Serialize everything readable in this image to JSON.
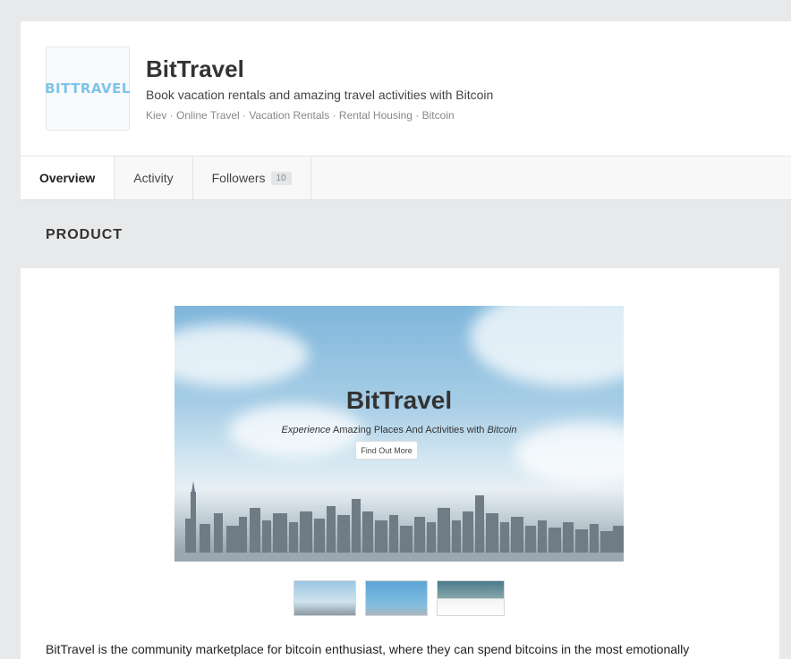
{
  "header": {
    "logo_text": "BITTRAVEL",
    "company_name": "BitTravel",
    "tagline": "Book vacation rentals and amazing travel activities with Bitcoin",
    "tags": [
      "Kiev",
      "Online Travel",
      "Vacation Rentals",
      "Rental Housing",
      "Bitcoin"
    ],
    "tag_separator": " · "
  },
  "tabs": [
    {
      "label": "Overview",
      "active": true
    },
    {
      "label": "Activity",
      "active": false
    },
    {
      "label": "Followers",
      "active": false,
      "badge": "10"
    }
  ],
  "section": {
    "title": "PRODUCT"
  },
  "hero": {
    "title": "BitTravel",
    "subtitle_prefix": "Experience",
    "subtitle_middle": " Amazing Places And Activities with ",
    "subtitle_suffix": "Bitcoin",
    "button_label": "Find Out More"
  },
  "description": "BitTravel is the community marketplace for bitcoin enthusiast, where they can spend bitcoins in the most emotionally",
  "colors": {
    "logo": "#7cc4ea",
    "page_bg": "#e8e9eb"
  }
}
